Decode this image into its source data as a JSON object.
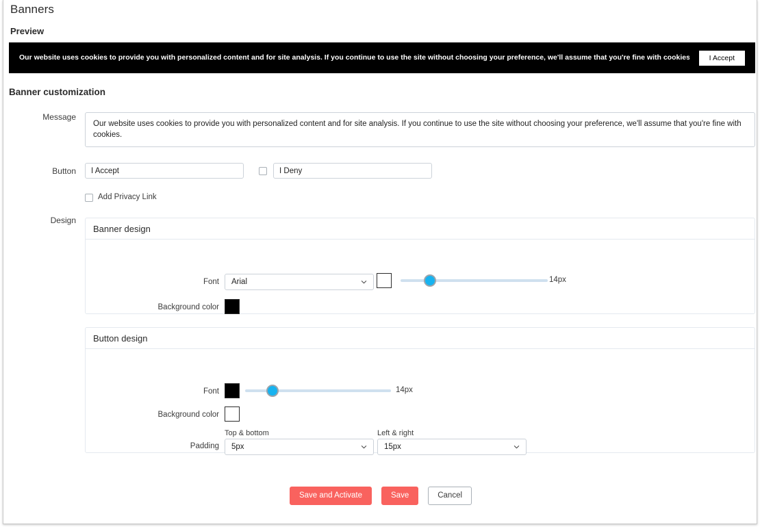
{
  "page": {
    "title": "Banners",
    "preview_label": "Preview",
    "section_title": "Banner customization"
  },
  "preview": {
    "message": "Our website uses cookies to provide you with personalized content and for site analysis. If you continue to use the site without choosing your preference, we'll assume that you're fine with cookies.",
    "accept_button": "I Accept",
    "background_color": "#000000",
    "text_color": "#ffffff"
  },
  "form": {
    "message_label": "Message",
    "message_value": "Our website uses cookies to provide you with personalized content and for site analysis. If you continue to use the site without choosing your preference, we'll assume that you're fine with cookies.",
    "button_label": "Button",
    "accept_value": "I Accept",
    "deny_value": "I Deny",
    "deny_enabled": false,
    "privacy_link_label": "Add Privacy Link",
    "privacy_link_checked": false,
    "design_label": "Design"
  },
  "banner_design": {
    "panel_title": "Banner design",
    "font_label": "Font",
    "font_value": "Arial",
    "font_color": "#ffffff",
    "font_size_value": "14px",
    "font_size_percent": 20,
    "background_color_label": "Background color",
    "background_color": "#000000"
  },
  "button_design": {
    "panel_title": "Button design",
    "font_label": "Font",
    "font_color": "#000000",
    "font_size_value": "14px",
    "font_size_percent": 19,
    "background_color_label": "Background color",
    "background_color": "#ffffff",
    "padding_label": "Padding",
    "top_bottom_label": "Top & bottom",
    "top_bottom_value": "5px",
    "left_right_label": "Left & right",
    "left_right_value": "15px"
  },
  "footer": {
    "save_and_activate": "Save and Activate",
    "save": "Save",
    "cancel": "Cancel",
    "accent_color": "#f9625e"
  }
}
